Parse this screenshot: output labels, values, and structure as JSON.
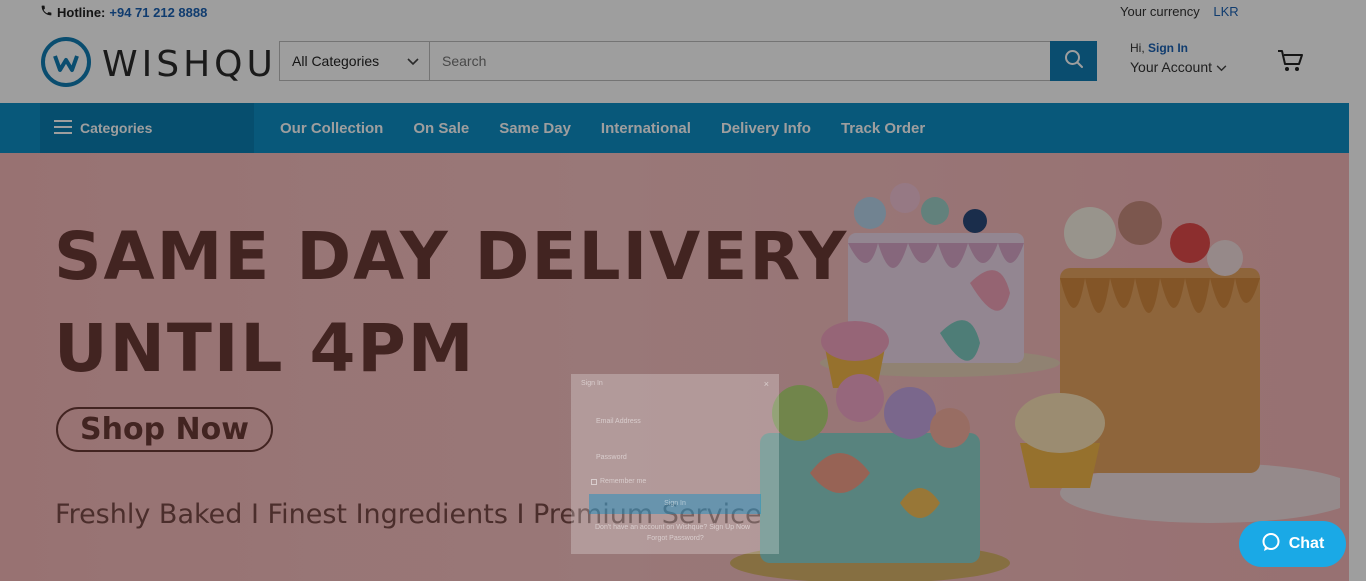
{
  "topbar": {
    "hotline_label": "Hotline:",
    "hotline_number": "+94 71 212 8888",
    "currency_label": "Your currency",
    "currency_code": "LKR"
  },
  "header": {
    "logo_text": "WISHQUE",
    "category_select": "All Categories",
    "search_placeholder": "Search",
    "greeting": "Hi,",
    "sign_in": "Sign In",
    "account_label": "Your Account"
  },
  "nav": {
    "categories_label": "Categories",
    "links": [
      "Our Collection",
      "On Sale",
      "Same Day",
      "International",
      "Delivery Info",
      "Track Order"
    ]
  },
  "hero": {
    "title_line1": "SAME DAY DELIVERY",
    "title_line2": "UNTIL 4PM",
    "cta": "Shop Now",
    "tagline": "Freshly Baked   I   Finest Ingredients   I   Premium Service"
  },
  "modal": {
    "title": "Sign In",
    "email_placeholder": "Email Address",
    "password_placeholder": "Password",
    "remember": "Remember me",
    "submit": "Sign In",
    "no_account": "Don't have an account on Wishque?",
    "signup": "Sign Up Now",
    "forgot": "Forgot Password?"
  },
  "chat": {
    "label": "Chat"
  },
  "colors": {
    "brand_blue": "#0d8ec5",
    "link_blue": "#1b62b3",
    "hero_pink": "#f6b9b9",
    "hero_text": "#6b3a36"
  }
}
